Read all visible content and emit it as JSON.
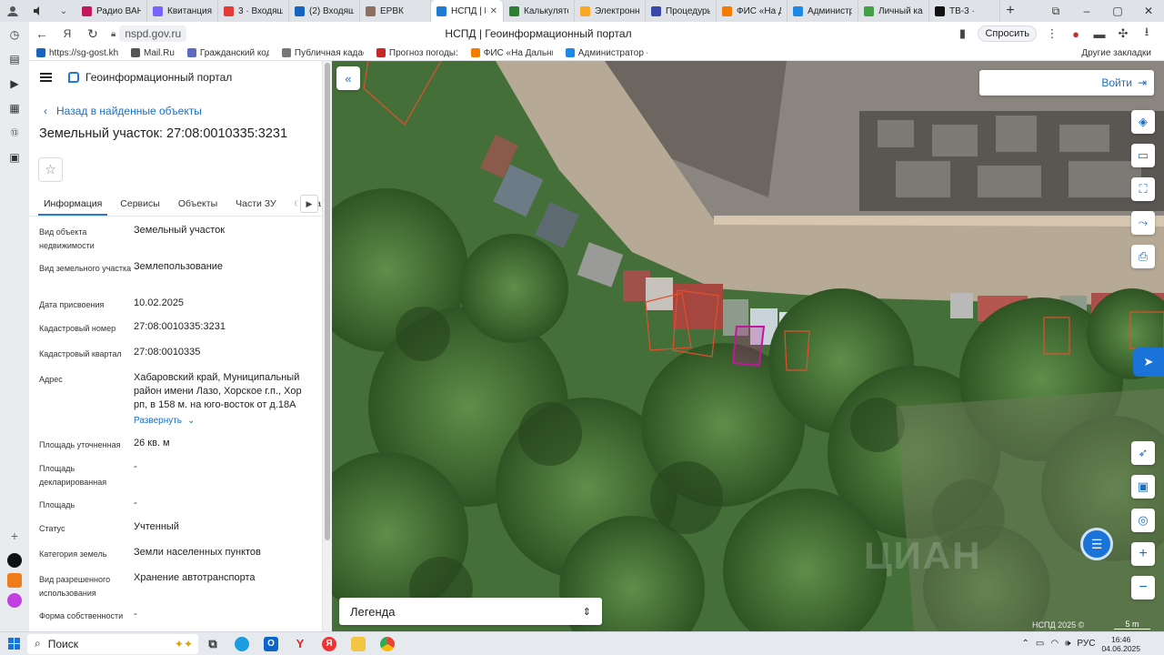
{
  "browser": {
    "tabs": [
      {
        "label": "Радио ВАН",
        "color": "#c2185b"
      },
      {
        "label": "Квитанция",
        "color": "#7b61ff"
      },
      {
        "label": "3 · Входящи",
        "color": "#e53935"
      },
      {
        "label": "(2) Входящи",
        "color": "#1565c0"
      },
      {
        "label": "ЕРВК",
        "color": "#8d6e63"
      },
      {
        "label": "НСПД | Г",
        "color": "#1f7ad6",
        "active": true
      },
      {
        "label": "Калькулято",
        "color": "#2e7d32"
      },
      {
        "label": "Электронн",
        "color": "#f9a825"
      },
      {
        "label": "Процедуры",
        "color": "#3949ab"
      },
      {
        "label": "ФИС «На Д",
        "color": "#f57c00"
      },
      {
        "label": "Администр",
        "color": "#1e88e5"
      },
      {
        "label": "Личный каб",
        "color": "#43a047"
      },
      {
        "label": "ТВ-3 ·",
        "color": "#111111"
      }
    ],
    "url": "nspd.gov.ru",
    "page_title": "НСПД | Геоинформационный портал",
    "ask_label": "Спросить",
    "bookmarks": [
      {
        "label": "https://sg-gost.kh",
        "color": "#1565c0"
      },
      {
        "label": "Mail.Ru",
        "color": "#555555"
      },
      {
        "label": "Гражданский код",
        "color": "#5c6bc0"
      },
      {
        "label": "Публичная кадаст",
        "color": "#777777"
      },
      {
        "label": "Прогноз погоды:",
        "color": "#c62828"
      },
      {
        "label": "ФИС «На Дальни",
        "color": "#f57c00"
      },
      {
        "label": "Администратор -",
        "color": "#1e88e5"
      }
    ],
    "other_bookmarks": "Другие закладки"
  },
  "panel": {
    "app_name": "Геоинформационный портал",
    "back_label": "Назад в найденные объекты",
    "title": "Земельный участок: 27:08:0010335:3231",
    "tabs": [
      "Информация",
      "Сервисы",
      "Объекты",
      "Части ЗУ",
      "Соста"
    ],
    "properties": [
      {
        "label": "Вид объекта недвижимости",
        "value": "Земельный участок"
      },
      {
        "label": "Вид земельного участка",
        "value": "Землепользование"
      },
      {
        "label": "Дата присвоения",
        "value": "10.02.2025"
      },
      {
        "label": "Кадастровый номер",
        "value": "27:08:0010335:3231"
      },
      {
        "label": "Кадастровый квартал",
        "value": "27:08:0010335"
      },
      {
        "label": "Адрес",
        "value": "Хабаровский край, Муниципальный район имени Лазо, Хорское г.п., Хор рп, в 158 м. на юго-восток от д.18А"
      },
      {
        "label": "Площадь уточненная",
        "value": "26 кв. м"
      },
      {
        "label": "Площадь декларированная",
        "value": "-"
      },
      {
        "label": "Площадь",
        "value": "-"
      },
      {
        "label": "Статус",
        "value": "Учтенный"
      },
      {
        "label": "Категория земель",
        "value": "Земли населенных пунктов"
      },
      {
        "label": "Вид разрешенного использования",
        "value": "Хранение автотранспорта"
      },
      {
        "label": "Форма собственности",
        "value": "-"
      }
    ],
    "expand_label": "Развернуть"
  },
  "map": {
    "login_label": "Войти",
    "legend_label": "Легенда",
    "attribution": "НСПД 2025 ©",
    "scale_label": "5 m",
    "watermark": "ЦИАН"
  },
  "taskbar": {
    "search_label": "Поиск",
    "lang": "РУС",
    "time": "16:46",
    "date": "04.06.2025"
  },
  "colors": {
    "accent": "#1a73d9",
    "link": "#1a6fc4",
    "parcel_selected": "#c2179c",
    "parcel_other": "#e0502e"
  }
}
